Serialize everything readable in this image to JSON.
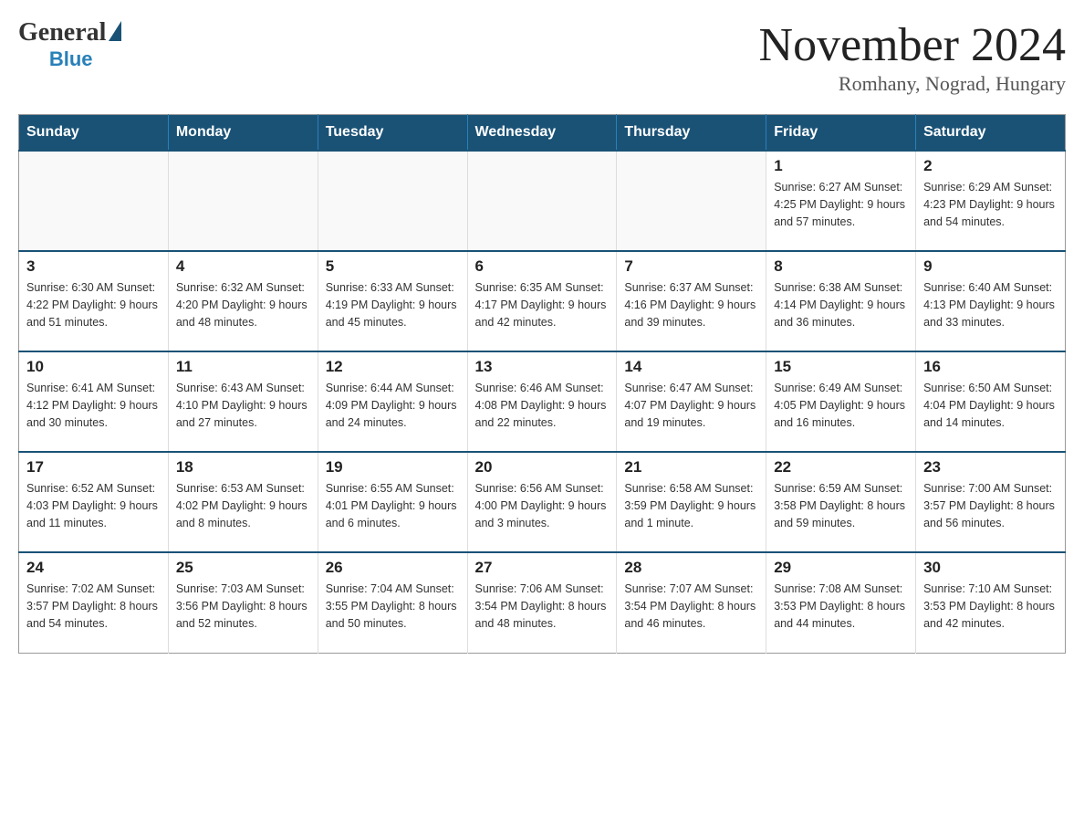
{
  "header": {
    "logo_general": "General",
    "logo_blue": "Blue",
    "title": "November 2024",
    "location": "Romhany, Nograd, Hungary"
  },
  "days_of_week": [
    "Sunday",
    "Monday",
    "Tuesday",
    "Wednesday",
    "Thursday",
    "Friday",
    "Saturday"
  ],
  "weeks": [
    {
      "days": [
        {
          "number": "",
          "info": "",
          "empty": true
        },
        {
          "number": "",
          "info": "",
          "empty": true
        },
        {
          "number": "",
          "info": "",
          "empty": true
        },
        {
          "number": "",
          "info": "",
          "empty": true
        },
        {
          "number": "",
          "info": "",
          "empty": true
        },
        {
          "number": "1",
          "info": "Sunrise: 6:27 AM\nSunset: 4:25 PM\nDaylight: 9 hours\nand 57 minutes."
        },
        {
          "number": "2",
          "info": "Sunrise: 6:29 AM\nSunset: 4:23 PM\nDaylight: 9 hours\nand 54 minutes."
        }
      ]
    },
    {
      "days": [
        {
          "number": "3",
          "info": "Sunrise: 6:30 AM\nSunset: 4:22 PM\nDaylight: 9 hours\nand 51 minutes."
        },
        {
          "number": "4",
          "info": "Sunrise: 6:32 AM\nSunset: 4:20 PM\nDaylight: 9 hours\nand 48 minutes."
        },
        {
          "number": "5",
          "info": "Sunrise: 6:33 AM\nSunset: 4:19 PM\nDaylight: 9 hours\nand 45 minutes."
        },
        {
          "number": "6",
          "info": "Sunrise: 6:35 AM\nSunset: 4:17 PM\nDaylight: 9 hours\nand 42 minutes."
        },
        {
          "number": "7",
          "info": "Sunrise: 6:37 AM\nSunset: 4:16 PM\nDaylight: 9 hours\nand 39 minutes."
        },
        {
          "number": "8",
          "info": "Sunrise: 6:38 AM\nSunset: 4:14 PM\nDaylight: 9 hours\nand 36 minutes."
        },
        {
          "number": "9",
          "info": "Sunrise: 6:40 AM\nSunset: 4:13 PM\nDaylight: 9 hours\nand 33 minutes."
        }
      ]
    },
    {
      "days": [
        {
          "number": "10",
          "info": "Sunrise: 6:41 AM\nSunset: 4:12 PM\nDaylight: 9 hours\nand 30 minutes."
        },
        {
          "number": "11",
          "info": "Sunrise: 6:43 AM\nSunset: 4:10 PM\nDaylight: 9 hours\nand 27 minutes."
        },
        {
          "number": "12",
          "info": "Sunrise: 6:44 AM\nSunset: 4:09 PM\nDaylight: 9 hours\nand 24 minutes."
        },
        {
          "number": "13",
          "info": "Sunrise: 6:46 AM\nSunset: 4:08 PM\nDaylight: 9 hours\nand 22 minutes."
        },
        {
          "number": "14",
          "info": "Sunrise: 6:47 AM\nSunset: 4:07 PM\nDaylight: 9 hours\nand 19 minutes."
        },
        {
          "number": "15",
          "info": "Sunrise: 6:49 AM\nSunset: 4:05 PM\nDaylight: 9 hours\nand 16 minutes."
        },
        {
          "number": "16",
          "info": "Sunrise: 6:50 AM\nSunset: 4:04 PM\nDaylight: 9 hours\nand 14 minutes."
        }
      ]
    },
    {
      "days": [
        {
          "number": "17",
          "info": "Sunrise: 6:52 AM\nSunset: 4:03 PM\nDaylight: 9 hours\nand 11 minutes."
        },
        {
          "number": "18",
          "info": "Sunrise: 6:53 AM\nSunset: 4:02 PM\nDaylight: 9 hours\nand 8 minutes."
        },
        {
          "number": "19",
          "info": "Sunrise: 6:55 AM\nSunset: 4:01 PM\nDaylight: 9 hours\nand 6 minutes."
        },
        {
          "number": "20",
          "info": "Sunrise: 6:56 AM\nSunset: 4:00 PM\nDaylight: 9 hours\nand 3 minutes."
        },
        {
          "number": "21",
          "info": "Sunrise: 6:58 AM\nSunset: 3:59 PM\nDaylight: 9 hours\nand 1 minute."
        },
        {
          "number": "22",
          "info": "Sunrise: 6:59 AM\nSunset: 3:58 PM\nDaylight: 8 hours\nand 59 minutes."
        },
        {
          "number": "23",
          "info": "Sunrise: 7:00 AM\nSunset: 3:57 PM\nDaylight: 8 hours\nand 56 minutes."
        }
      ]
    },
    {
      "days": [
        {
          "number": "24",
          "info": "Sunrise: 7:02 AM\nSunset: 3:57 PM\nDaylight: 8 hours\nand 54 minutes."
        },
        {
          "number": "25",
          "info": "Sunrise: 7:03 AM\nSunset: 3:56 PM\nDaylight: 8 hours\nand 52 minutes."
        },
        {
          "number": "26",
          "info": "Sunrise: 7:04 AM\nSunset: 3:55 PM\nDaylight: 8 hours\nand 50 minutes."
        },
        {
          "number": "27",
          "info": "Sunrise: 7:06 AM\nSunset: 3:54 PM\nDaylight: 8 hours\nand 48 minutes."
        },
        {
          "number": "28",
          "info": "Sunrise: 7:07 AM\nSunset: 3:54 PM\nDaylight: 8 hours\nand 46 minutes."
        },
        {
          "number": "29",
          "info": "Sunrise: 7:08 AM\nSunset: 3:53 PM\nDaylight: 8 hours\nand 44 minutes."
        },
        {
          "number": "30",
          "info": "Sunrise: 7:10 AM\nSunset: 3:53 PM\nDaylight: 8 hours\nand 42 minutes."
        }
      ]
    }
  ]
}
